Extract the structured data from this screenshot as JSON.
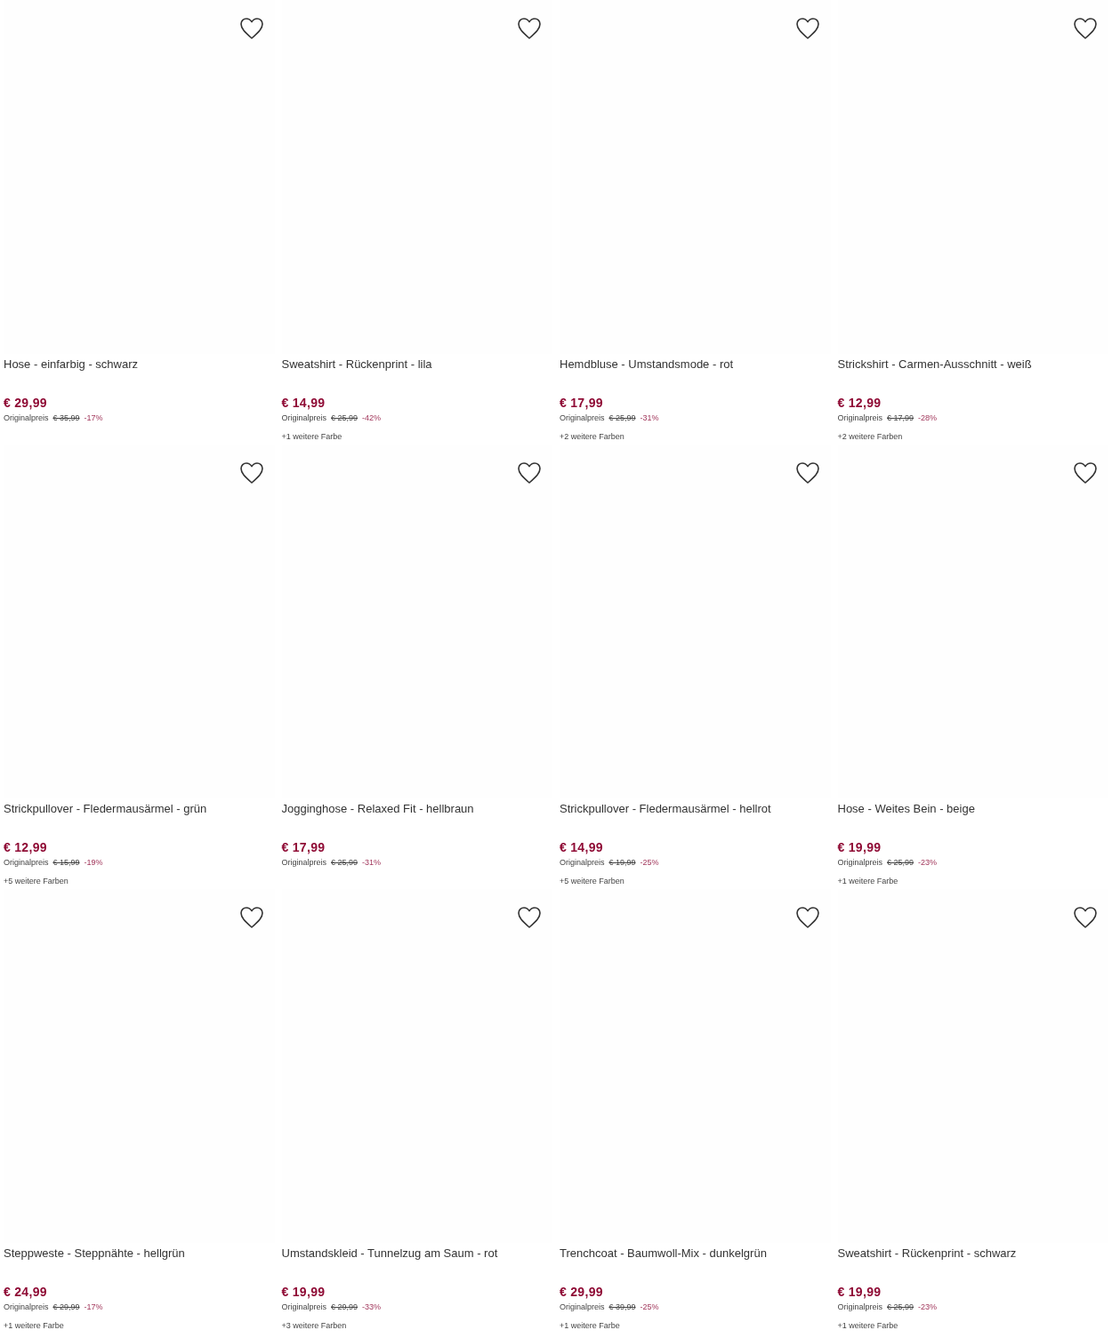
{
  "products": [
    {
      "title": "Hose - einfarbig - schwarz",
      "price": "€ 29,99",
      "original_label": "Originalpreis",
      "original_price": "€ 35,99",
      "discount": "-17%",
      "favorite": false
    },
    {
      "title": "Sweatshirt - Rückenprint - lila",
      "price": "€ 14,99",
      "original_label": "Originalpreis",
      "original_price": "€ 25,99",
      "discount": "-42%",
      "more_colors": "+1 weitere Farbe",
      "favorite": false
    },
    {
      "title": "Hemdbluse - Umstandsmode - rot",
      "price": "€ 17,99",
      "original_label": "Originalpreis",
      "original_price": "€ 25,99",
      "discount": "-31%",
      "more_colors": "+2 weitere Farben",
      "favorite": false
    },
    {
      "title": "Strickshirt - Carmen-Ausschnitt - weiß",
      "price": "€ 12,99",
      "original_label": "Originalpreis",
      "original_price": "€ 17,99",
      "discount": "-28%",
      "more_colors": "+2 weitere Farben",
      "favorite": false
    },
    {
      "title": "Strickpullover - Fledermausärmel - grün",
      "price": "€ 12,99",
      "original_label": "Originalpreis",
      "original_price": "€ 15,99",
      "discount": "-19%",
      "more_colors": "+5 weitere Farben",
      "favorite": false
    },
    {
      "title": "Jogginghose - Relaxed Fit - hellbraun",
      "price": "€ 17,99",
      "original_label": "Originalpreis",
      "original_price": "€ 25,99",
      "discount": "-31%",
      "favorite": false
    },
    {
      "title": "Strickpullover - Fledermausärmel - hellrot",
      "price": "€ 14,99",
      "original_label": "Originalpreis",
      "original_price": "€ 19,99",
      "discount": "-25%",
      "more_colors": "+5 weitere Farben",
      "favorite": false
    },
    {
      "title": "Hose - Weites Bein - beige",
      "price": "€ 19,99",
      "original_label": "Originalpreis",
      "original_price": "€ 25,99",
      "discount": "-23%",
      "more_colors": "+1 weitere Farbe",
      "favorite": false
    },
    {
      "title": "Steppweste - Steppnähte - hellgrün",
      "price": "€ 24,99",
      "original_label": "Originalpreis",
      "original_price": "€ 29,99",
      "discount": "-17%",
      "more_colors": "+1 weitere Farbe",
      "favorite": false
    },
    {
      "title": "Umstandskleid - Tunnelzug am Saum - rot",
      "price": "€ 19,99",
      "original_label": "Originalpreis",
      "original_price": "€ 29,99",
      "discount": "-33%",
      "more_colors": "+3 weitere Farben",
      "favorite": false
    },
    {
      "title": "Trenchcoat - Baumwoll-Mix - dunkelgrün",
      "price": "€ 29,99",
      "original_label": "Originalpreis",
      "original_price": "€ 39,99",
      "discount": "-25%",
      "more_colors": "+1 weitere Farbe",
      "favorite": false
    },
    {
      "title": "Sweatshirt - Rückenprint - schwarz",
      "price": "€ 19,99",
      "original_label": "Originalpreis",
      "original_price": "€ 25,99",
      "discount": "-23%",
      "more_colors": "+1 weitere Farbe",
      "favorite": false
    }
  ]
}
